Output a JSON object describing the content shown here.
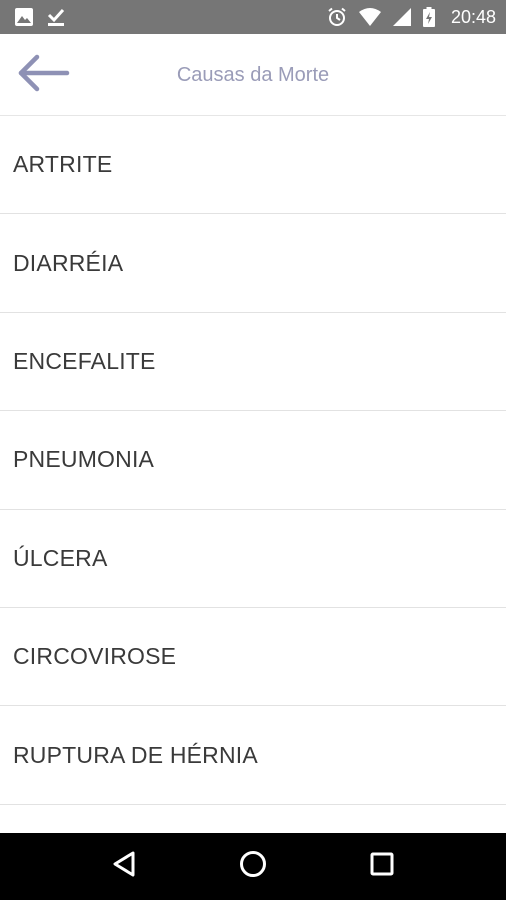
{
  "status_bar": {
    "time": "20:48",
    "icons": [
      "image-icon",
      "download-done-icon",
      "alarm-icon",
      "wifi-icon",
      "signal-icon",
      "battery-icon"
    ]
  },
  "app_bar": {
    "title": "Causas da Morte",
    "back_icon": "arrow-back-icon",
    "accent_color": "#8e91b5"
  },
  "list": {
    "items": [
      "ARTRITE",
      "DIARRÉIA",
      "ENCEFALITE",
      "PNEUMONIA",
      "ÚLCERA",
      "CIRCOVIROSE",
      "RUPTURA DE HÉRNIA"
    ]
  },
  "nav_bar": {
    "buttons": [
      "back-triangle-icon",
      "home-circle-icon",
      "recents-square-icon"
    ]
  }
}
